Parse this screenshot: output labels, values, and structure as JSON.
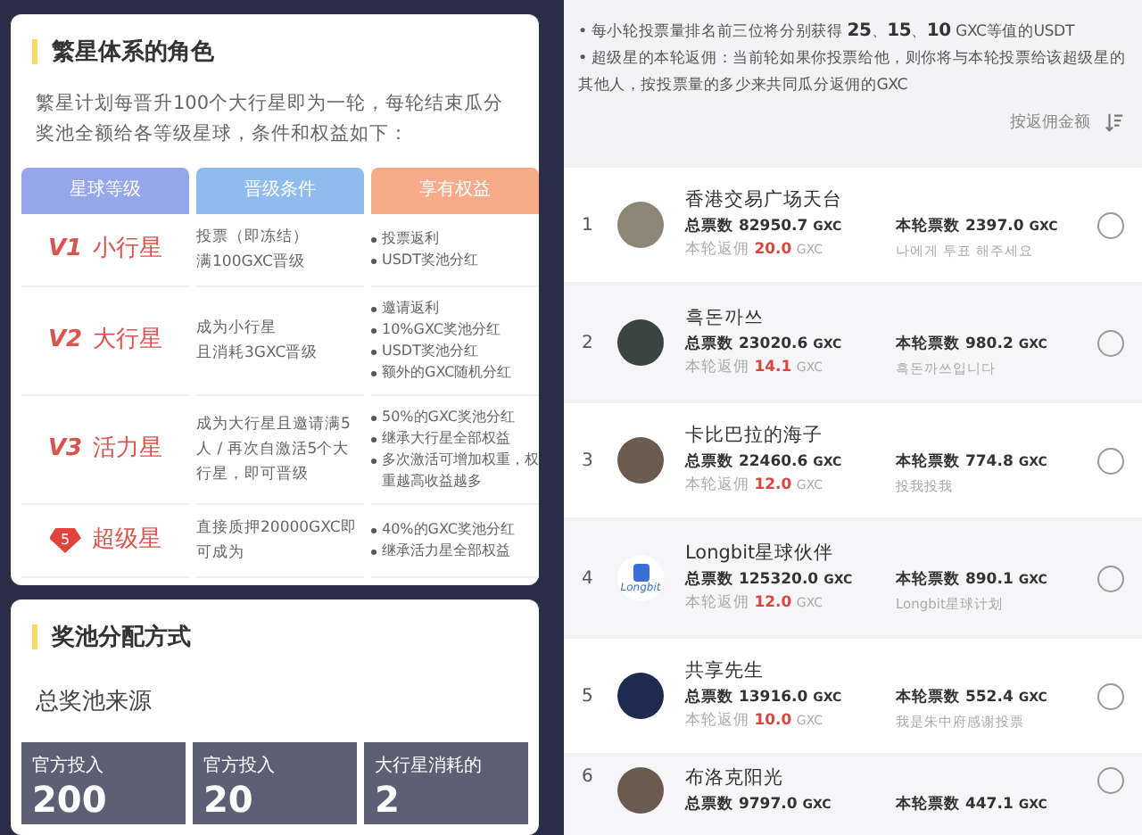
{
  "roles_card": {
    "title": "繁星体系的角色",
    "description": "繁星计划每晋升100个大行星即为一轮，每轮结束瓜分奖池全额给各等级星球，条件和权益如下：",
    "columns": [
      {
        "label": "星球等级",
        "color": "#95a6ea"
      },
      {
        "label": "晋级条件",
        "color": "#8fbbee"
      },
      {
        "label": "享有权益",
        "color": "#f8ab8a"
      }
    ],
    "rows": [
      {
        "kind": "level",
        "level_code": "V1",
        "name": "小行星",
        "conditions": [
          "投票（即冻结）",
          "满100GXC晋级"
        ],
        "benefits": [
          "投票返利",
          "USDT奖池分红"
        ]
      },
      {
        "kind": "level",
        "level_code": "V2",
        "name": "大行星",
        "conditions": [
          "成为小行星",
          "且消耗3GXC晋级"
        ],
        "benefits": [
          "邀请返利",
          "10%GXC奖池分红",
          "USDT奖池分红",
          "额外的GXC随机分红"
        ]
      },
      {
        "kind": "level",
        "level_code": "V3",
        "name": "活力星",
        "conditions": [
          "成为大行星且邀请满5人 / 再次自激活5个大行星，即可晋级"
        ],
        "benefits": [
          "50%的GXC奖池分红",
          "继承大行星全部权益",
          "多次激活可增加权重，权重越高收益越多"
        ]
      },
      {
        "kind": "gem",
        "level_code": "5",
        "name": "超级星",
        "conditions": [
          "直接质押20000GXC即可成为"
        ],
        "benefits": [
          "40%的GXC奖池分红",
          "继承活力星全部权益"
        ]
      }
    ]
  },
  "pool_card": {
    "title": "奖池分配方式",
    "subtitle": "总奖池来源",
    "sources": [
      {
        "label": "官方投入",
        "value": "200"
      },
      {
        "label": "官方投入",
        "value": "20"
      },
      {
        "label": "大行星消耗的",
        "value": "2"
      }
    ]
  },
  "rules": [
    "• 每小轮投票量排名前三位将分别获得 **25**、**15**、**10** GXC等值的USDT",
    "• 超级星的本轮返佣：当前轮如果你投票给他，则你将与本轮投票给该超级星的其他人，按投票量的多少来共同瓜分返佣的GXC"
  ],
  "sort": {
    "label": "按返佣金额"
  },
  "candidates": [
    {
      "rank": "1",
      "name": "香港交易广场天台",
      "kind": "photo",
      "total_label": "总票数",
      "total": "82950.7",
      "total_unit": "GXC",
      "round_label": "本轮票数",
      "round": "2397.0",
      "round_unit": "GXC",
      "rebate_label": "本轮返佣",
      "rebate": "20.0",
      "rebate_unit": "GXC",
      "note": "나에게 투표 해주세요",
      "selected": false
    },
    {
      "rank": "2",
      "name": "흑돈까쓰",
      "kind": "photo",
      "total_label": "总票数",
      "total": "23020.6",
      "total_unit": "GXC",
      "round_label": "本轮票数",
      "round": "980.2",
      "round_unit": "GXC",
      "rebate_label": "本轮返佣",
      "rebate": "14.1",
      "rebate_unit": "GXC",
      "note": "흑돈까쓰입니다",
      "selected": false
    },
    {
      "rank": "3",
      "name": "卡比巴拉的海子",
      "kind": "photo",
      "total_label": "总票数",
      "total": "22460.6",
      "total_unit": "GXC",
      "round_label": "本轮票数",
      "round": "774.8",
      "round_unit": "GXC",
      "rebate_label": "本轮返佣",
      "rebate": "12.0",
      "rebate_unit": "GXC",
      "note": "投我投我",
      "selected": false
    },
    {
      "rank": "4",
      "name": "Longbit星球伙伴",
      "kind": "logo",
      "logo_text": "Longbit",
      "total_label": "总票数",
      "total": "125320.0",
      "total_unit": "GXC",
      "round_label": "本轮票数",
      "round": "890.1",
      "round_unit": "GXC",
      "rebate_label": "本轮返佣",
      "rebate": "12.0",
      "rebate_unit": "GXC",
      "note": "Longbit星球计划",
      "selected": false
    },
    {
      "rank": "5",
      "name": "共享先生",
      "kind": "photo",
      "total_label": "总票数",
      "total": "13916.0",
      "total_unit": "GXC",
      "round_label": "本轮票数",
      "round": "552.4",
      "round_unit": "GXC",
      "rebate_label": "本轮返佣",
      "rebate": "10.0",
      "rebate_unit": "GXC",
      "note": "我是朱中府感谢投票",
      "selected": false
    },
    {
      "rank": "6",
      "name": "布洛克阳光",
      "kind": "photo",
      "total_label": "总票数",
      "total": "9797.0",
      "total_unit": "GXC",
      "round_label": "本轮票数",
      "round": "447.1",
      "round_unit": "GXC",
      "selected": false
    }
  ]
}
